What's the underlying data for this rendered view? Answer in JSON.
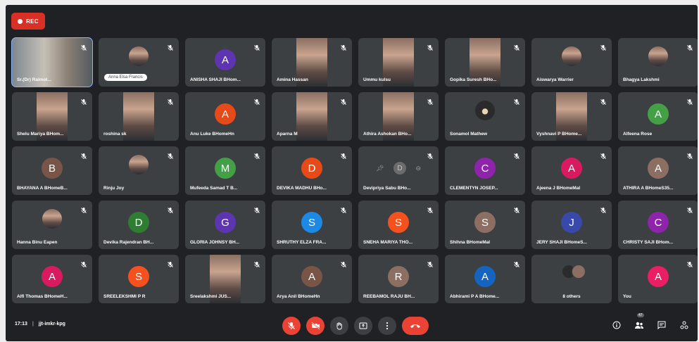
{
  "rec_label": "REC",
  "meeting": {
    "time": "17:13",
    "code": "jjt-imkr-kpg"
  },
  "participants_badge": "47",
  "tiles": [
    {
      "name": "Sr.(Dr) Raimol...",
      "kind": "photo-wide",
      "active": true
    },
    {
      "name": "Anna Elsa Francis",
      "kind": "photo-round",
      "pill": true
    },
    {
      "name": "ANISHA SHAJI BHom...",
      "initial": "A",
      "color": "#5e35b1"
    },
    {
      "name": "Amina Hassan",
      "kind": "photo"
    },
    {
      "name": "Ummu kulsu",
      "kind": "photo"
    },
    {
      "name": "Gopika Suresh BHo...",
      "kind": "photo"
    },
    {
      "name": "Aiswarya Warrier",
      "kind": "photo-round"
    },
    {
      "name": "Bhagya Lakshmi",
      "kind": "photo-round"
    },
    {
      "name": "Shelu Mariya BHom...",
      "kind": "photo"
    },
    {
      "name": "roshina sk",
      "kind": "photo"
    },
    {
      "name": "Anu Luke BHomeHn",
      "initial": "A",
      "color": "#e64a19"
    },
    {
      "name": "Aparna M",
      "kind": "photo"
    },
    {
      "name": "Athira Ashokan BHo...",
      "kind": "photo"
    },
    {
      "name": "Sonamol Mathew",
      "kind": "photo-dark"
    },
    {
      "name": "Vyshnavi P BHome...",
      "kind": "photo"
    },
    {
      "name": "Alfeena Rose",
      "initial": "A",
      "color": "#43a047"
    },
    {
      "name": "BHAYANA A BHomeB...",
      "initial": "B",
      "color": "#795548"
    },
    {
      "name": "Rinju Joy",
      "kind": "photo-round"
    },
    {
      "name": "Mufeeda Samad T B...",
      "initial": "M",
      "color": "#43a047"
    },
    {
      "name": "DEVIKA MADHU BHo...",
      "initial": "D",
      "color": "#e64a19"
    },
    {
      "name": "Devipriya Sabu BHo...",
      "initial": "D",
      "color": "#6b6b6b",
      "pinned": true
    },
    {
      "name": "CLEMENTYN JOSEP...",
      "initial": "C",
      "color": "#8e24aa"
    },
    {
      "name": "Ajeena J BHomeMal",
      "initial": "A",
      "color": "#d81b60"
    },
    {
      "name": "ATHIRA A BHomeS35...",
      "initial": "A",
      "color": "#8d6e63"
    },
    {
      "name": "Hanna Binu Eapen",
      "kind": "photo-round"
    },
    {
      "name": "Devika Rajendran BH...",
      "initial": "D",
      "color": "#2e7d32"
    },
    {
      "name": "GLORIA JOHNSY BH...",
      "initial": "G",
      "color": "#5e35b1"
    },
    {
      "name": "SHRUTHY ELZA FRA...",
      "initial": "S",
      "color": "#1e88e5"
    },
    {
      "name": "SNEHA MARIYA THO...",
      "initial": "S",
      "color": "#f4511e"
    },
    {
      "name": "Shihna BHomeMal",
      "initial": "S",
      "color": "#8d6e63"
    },
    {
      "name": "JERY SHAJI BHomeS...",
      "initial": "J",
      "color": "#3949ab"
    },
    {
      "name": "CHRISTY SAJI BHom...",
      "initial": "C",
      "color": "#8e24aa"
    },
    {
      "name": "Alfi Thomas BHomeH...",
      "initial": "A",
      "color": "#d81b60"
    },
    {
      "name": "SREELEKSHMI P R",
      "initial": "S",
      "color": "#f4511e"
    },
    {
      "name": "Sreelakshmi JUS...",
      "kind": "photo"
    },
    {
      "name": "Arya Anil BHomeHn",
      "initial": "A",
      "color": "#795548"
    },
    {
      "name": "REEBAMOL RAJU BH...",
      "initial": "R",
      "color": "#8d6e63"
    },
    {
      "name": "Abhirami P A BHome...",
      "initial": "A",
      "color": "#1565c0"
    },
    {
      "name": "8 others",
      "kind": "others",
      "center": true
    },
    {
      "name": "You",
      "initial": "A",
      "color": "#e91e63"
    }
  ],
  "colors": {
    "background": "#202124",
    "tile": "#3c4043",
    "accent_red": "#ea4335",
    "active_outline": "#8ab4f8"
  },
  "icons": {
    "controls": [
      "mic-off-icon",
      "camera-off-icon",
      "raise-hand-icon",
      "present-icon",
      "more-options-icon",
      "end-call-icon"
    ],
    "right": [
      "info-icon",
      "people-icon",
      "chat-icon",
      "activities-icon"
    ]
  }
}
